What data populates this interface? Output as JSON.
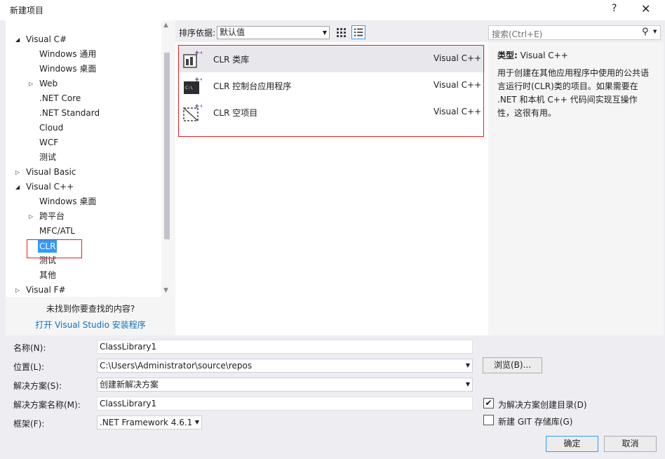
{
  "window": {
    "title": "新建项目",
    "help": "?",
    "close": "✕"
  },
  "tree": [
    {
      "label": "Visual C#",
      "toggle": "◢"
    },
    {
      "label": "Windows 通用",
      "toggle": ""
    },
    {
      "label": "Windows 桌面",
      "toggle": ""
    },
    {
      "label": "Web",
      "toggle": "▷"
    },
    {
      "label": ".NET Core",
      "toggle": ""
    },
    {
      "label": ".NET Standard",
      "toggle": ""
    },
    {
      "label": "Cloud",
      "toggle": ""
    },
    {
      "label": "WCF",
      "toggle": ""
    },
    {
      "label": "测试",
      "toggle": ""
    },
    {
      "label": "Visual Basic",
      "toggle": "▷"
    },
    {
      "label": "Visual C++",
      "toggle": "◢"
    },
    {
      "label": "Windows 桌面",
      "toggle": ""
    },
    {
      "label": "跨平台",
      "toggle": "▷"
    },
    {
      "label": "MFC/ATL",
      "toggle": ""
    },
    {
      "label": "CLR",
      "toggle": ""
    },
    {
      "label": "测试",
      "toggle": ""
    },
    {
      "label": "其他",
      "toggle": ""
    },
    {
      "label": "Visual F#",
      "toggle": "▷"
    }
  ],
  "not_found": "未找到你要查找的内容?",
  "installer_link": "打开 Visual Studio 安装程序",
  "sort": {
    "label": "排序依据:",
    "value": "默认值"
  },
  "search": {
    "placeholder": "搜索(Ctrl+E)"
  },
  "templates": [
    {
      "name": "CLR 类库",
      "lang": "Visual C++"
    },
    {
      "name": "CLR 控制台应用程序",
      "lang": "Visual C++"
    },
    {
      "name": "CLR 空项目",
      "lang": "Visual C++"
    }
  ],
  "description": {
    "type_label": "类型:",
    "type_value": "Visual C++",
    "text": "用于创建在其他应用程序中使用的公共语言运行时(CLR)类的项目。如果需要在 .NET 和本机 C++ 代码间实现互操作性，这很有用。"
  },
  "form": {
    "name_label": "名称(N):",
    "name_value": "ClassLibrary1",
    "location_label": "位置(L):",
    "location_value": "C:\\Users\\Administrator\\source\\repos",
    "browse_label": "浏览(B)...",
    "solution_label": "解决方案(S):",
    "solution_value": "创建新解决方案",
    "solution_name_label": "解决方案名称(M):",
    "solution_name_value": "ClassLibrary1",
    "framework_label": "框架(F):",
    "framework_value": ".NET Framework 4.6.1",
    "create_dir_label": "为解决方案创建目录(D)",
    "create_dir_checked": true,
    "git_label": "新建 GIT 存储库(G)",
    "git_checked": false,
    "ok_label": "确定",
    "cancel_label": "取消"
  }
}
